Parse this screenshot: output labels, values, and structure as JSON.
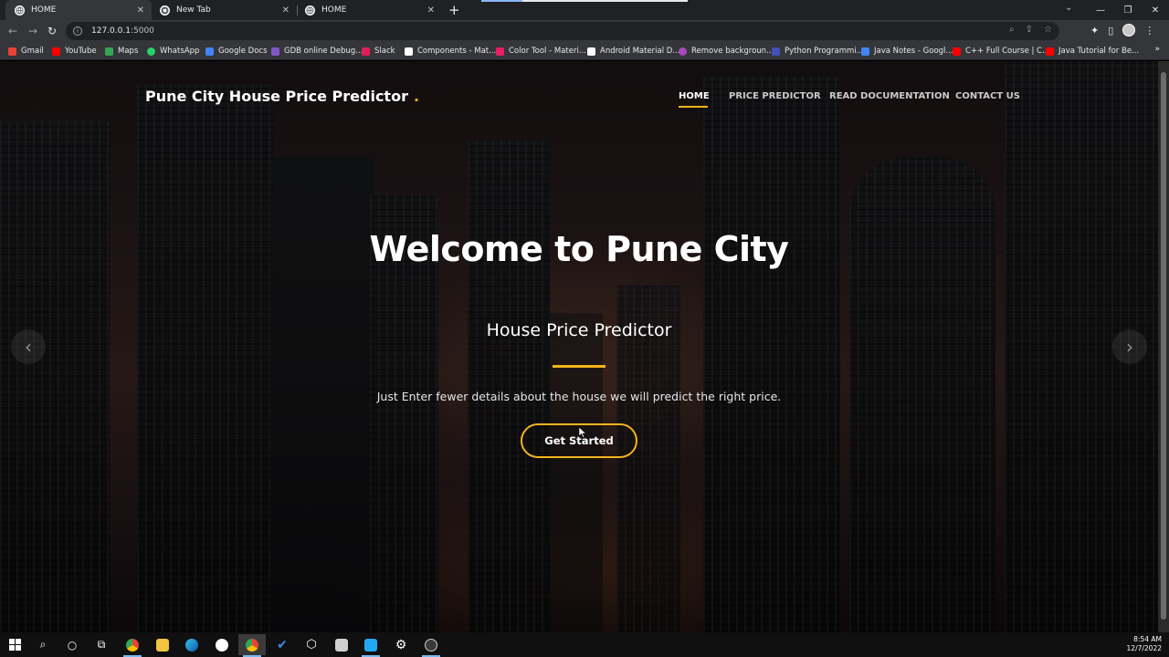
{
  "browser": {
    "tabs": [
      {
        "title": "HOME",
        "active": true
      },
      {
        "title": "New Tab",
        "active": false
      },
      {
        "title": "HOME",
        "active": false
      }
    ],
    "new_tab_symbol": "+",
    "url": {
      "host": "127.0.0.1",
      "port": ":5000"
    },
    "bookmarks": [
      {
        "label": "Gmail",
        "icon": "gmail-icon",
        "color": "#ea4335"
      },
      {
        "label": "YouTube",
        "icon": "youtube-icon",
        "color": "#ff0000"
      },
      {
        "label": "Maps",
        "icon": "maps-icon",
        "color": "#34a853"
      },
      {
        "label": "WhatsApp",
        "icon": "whatsapp-icon",
        "color": "#25d366"
      },
      {
        "label": "Google Docs",
        "icon": "docs-icon",
        "color": "#4285f4"
      },
      {
        "label": "GDB online Debug...",
        "icon": "gdb-icon",
        "color": "#7e57c2"
      },
      {
        "label": "Slack",
        "icon": "slack-icon",
        "color": "#e01e5a"
      },
      {
        "label": "Components - Mat...",
        "icon": "page-icon",
        "color": "#ffffff"
      },
      {
        "label": "Color Tool - Materi...",
        "icon": "color-tool-icon",
        "color": "#e91e63"
      },
      {
        "label": "Android Material D...",
        "icon": "page-icon",
        "color": "#ffffff"
      },
      {
        "label": "Remove backgroun...",
        "icon": "removebg-icon",
        "color": "#ab47bc"
      },
      {
        "label": "Python Programmi...",
        "icon": "python-icon",
        "color": "#3f51b5"
      },
      {
        "label": "Java Notes - Googl...",
        "icon": "docs-icon",
        "color": "#4285f4"
      },
      {
        "label": "C++ Full Course | C...",
        "icon": "youtube-icon",
        "color": "#ff0000"
      },
      {
        "label": "Java Tutorial for Be...",
        "icon": "youtube-icon",
        "color": "#ff0000"
      }
    ],
    "bookmarks_more": "»"
  },
  "site": {
    "brand": "Pune City House Price Predictor",
    "brand_dot": ".",
    "nav": [
      {
        "label": "HOME",
        "active": true
      },
      {
        "label": "PRICE PREDICTOR",
        "active": false
      },
      {
        "label": "READ DOCUMENTATION",
        "active": false
      },
      {
        "label": "CONTACT US",
        "active": false
      }
    ],
    "hero": {
      "title": "Welcome to Pune City",
      "subtitle": "House Price Predictor",
      "description": "Just Enter fewer details about the house we will predict the right price.",
      "cta": "Get Started"
    },
    "carousel": {
      "prev": "‹",
      "next": "›"
    },
    "accent_color": "#f2b41c"
  },
  "taskbar": {
    "clock_time": "8:54 AM",
    "clock_date": "12/7/2022"
  }
}
